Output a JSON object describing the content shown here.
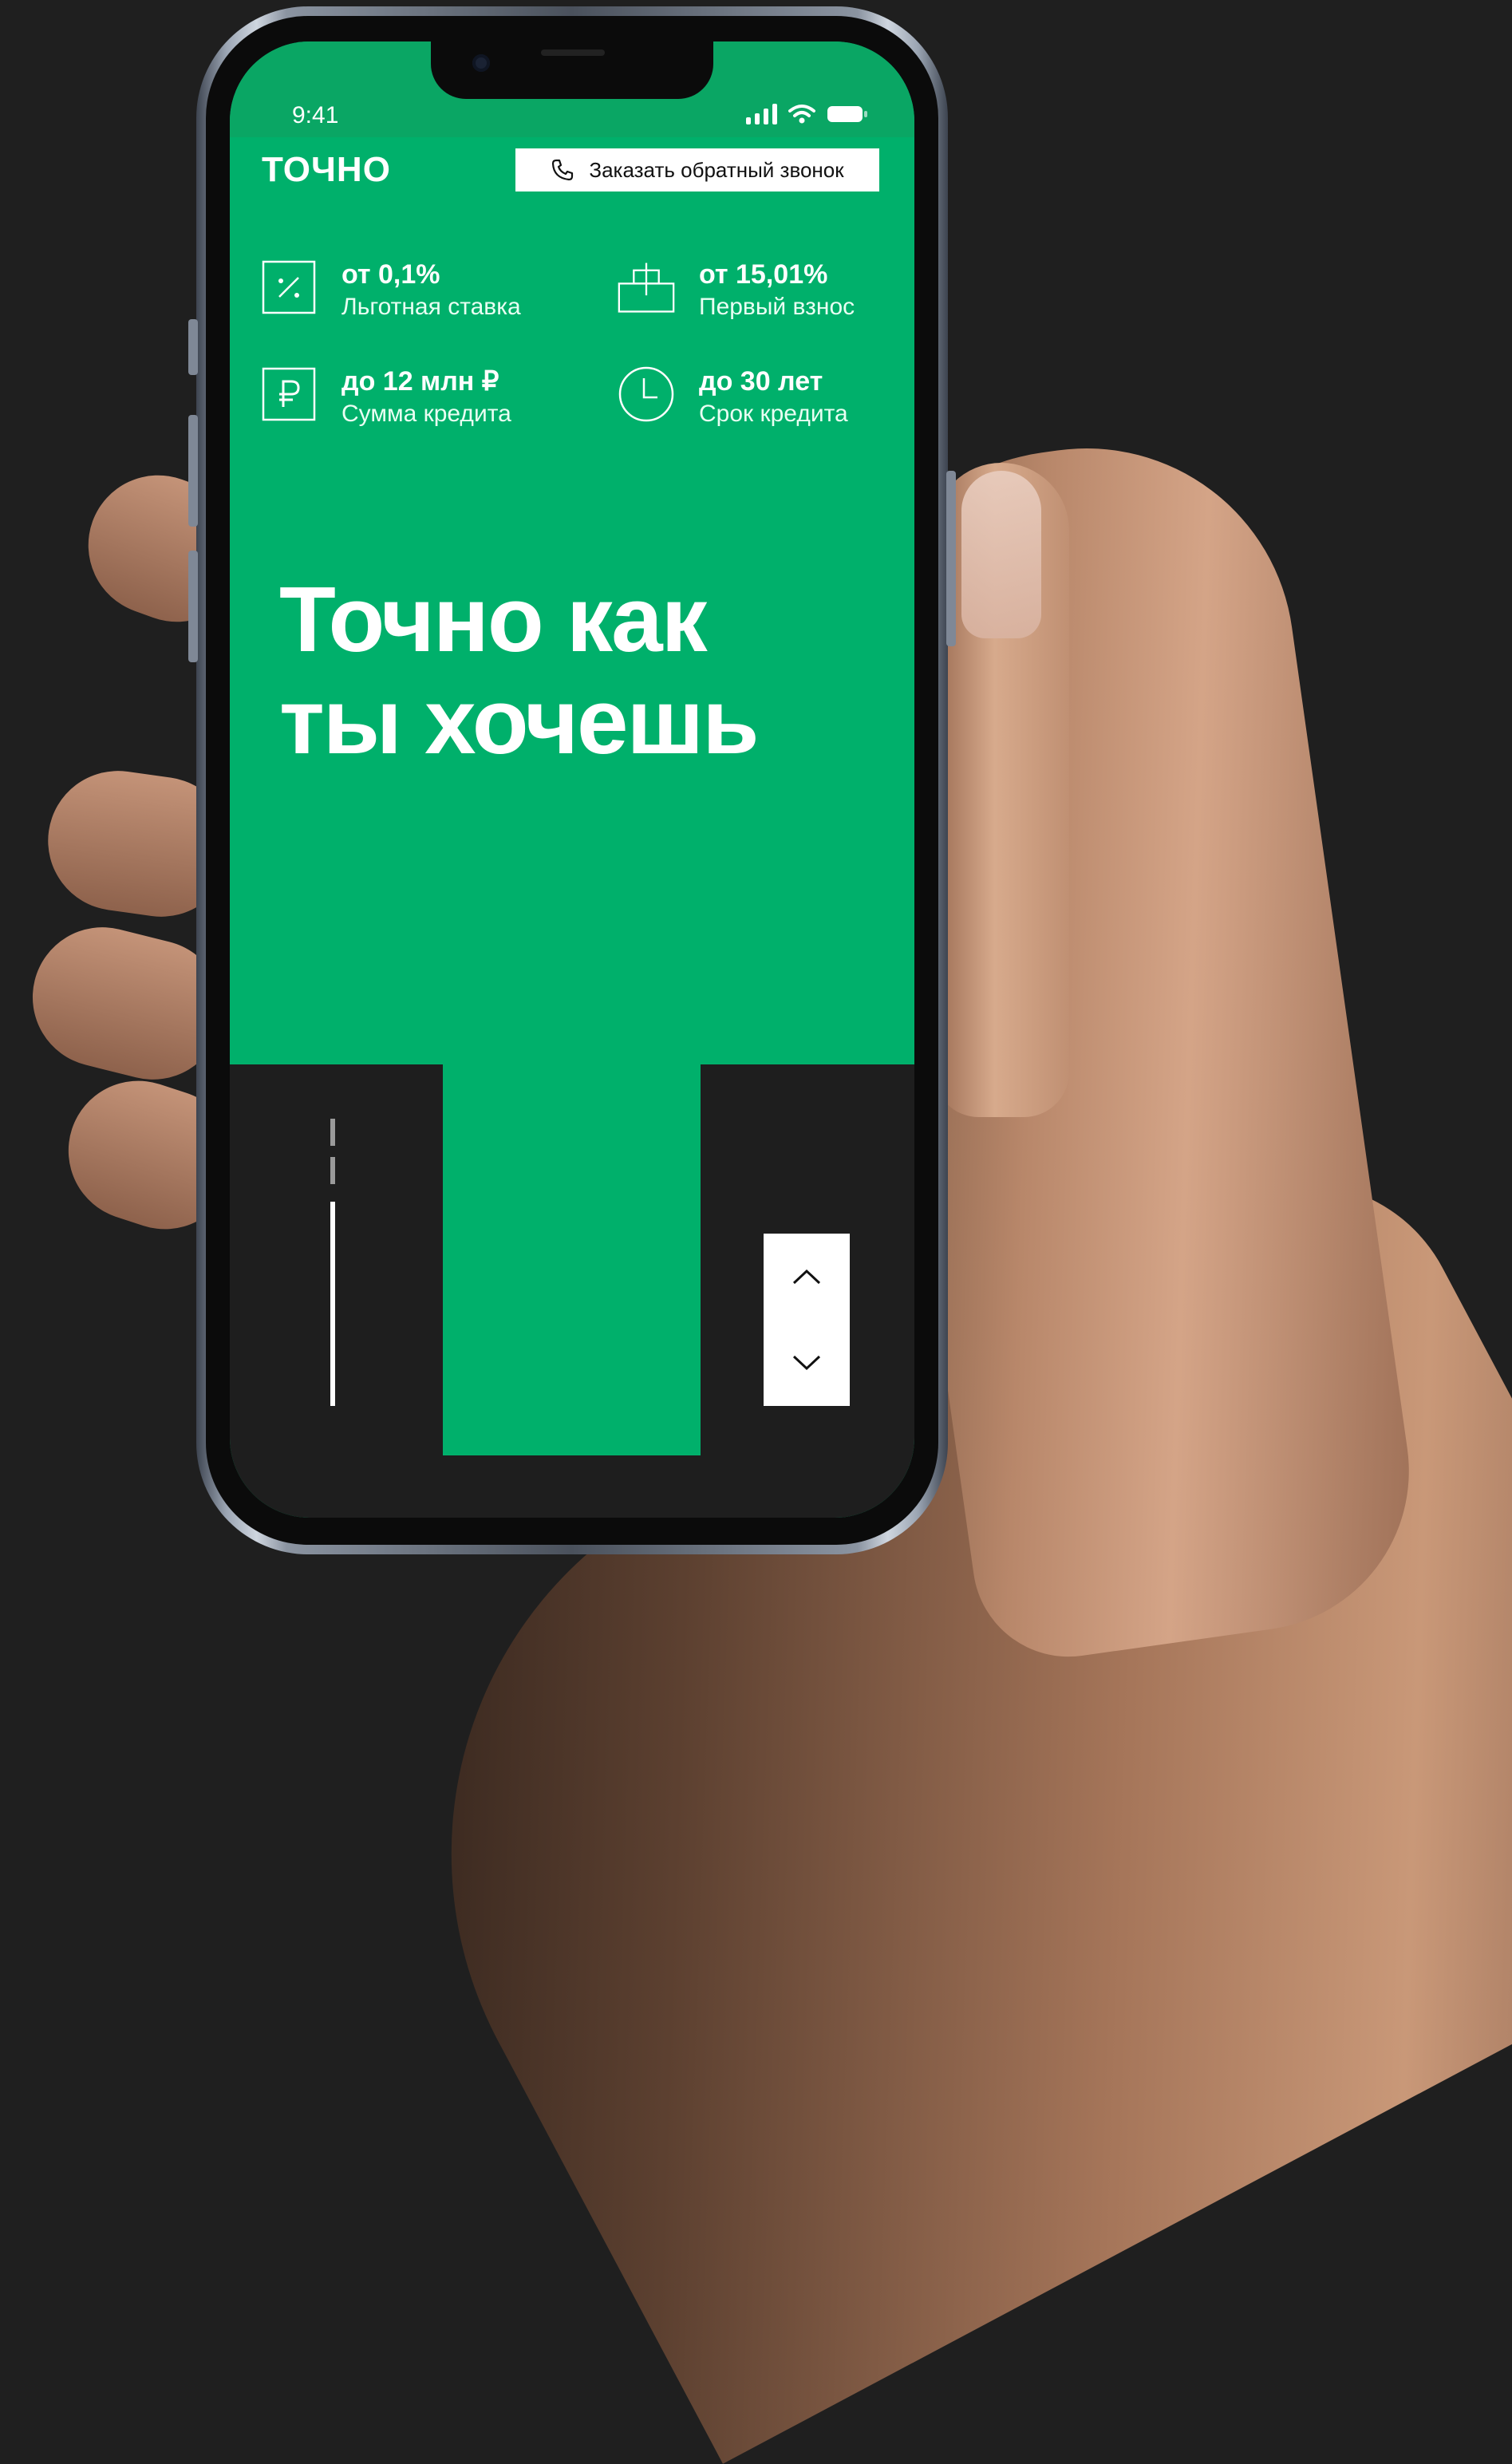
{
  "status_bar": {
    "time": "9:41"
  },
  "header": {
    "logo": "ТОЧНО",
    "callback_label": "Заказать обратный звонок"
  },
  "features": [
    {
      "value": "от 0,1%",
      "label": "Льготная ставка",
      "icon": "percent-icon"
    },
    {
      "value": "от 15,01%",
      "label": "Первый взнос",
      "icon": "building-icon"
    },
    {
      "value": "до 12 млн ₽",
      "label": "Сумма кредита",
      "icon": "ruble-icon"
    },
    {
      "value": "до 30 лет",
      "label": "Срок кредита",
      "icon": "clock-icon"
    }
  ],
  "hero": {
    "line1": "Точно как",
    "line2": "ты хочешь"
  },
  "slider": {
    "total": 3,
    "current": 3
  },
  "colors": {
    "brand_green": "#00b06b",
    "dark": "#1e1e1e",
    "white": "#ffffff"
  }
}
